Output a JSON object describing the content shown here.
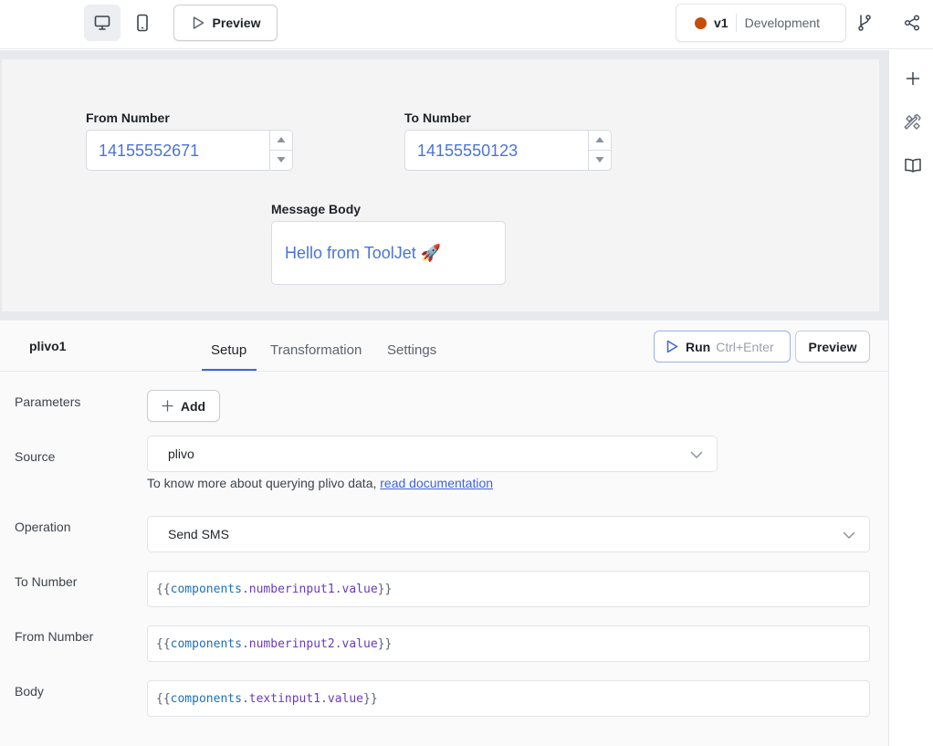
{
  "topbar": {
    "preview_label": "Preview",
    "version_label": "v1",
    "environment_label": "Development"
  },
  "canvas": {
    "from_number_label": "From Number",
    "from_number_value": "14155552671",
    "to_number_label": "To Number",
    "to_number_value": "14155550123",
    "message_body_label": "Message Body",
    "message_body_value": "Hello from ToolJet 🚀"
  },
  "query": {
    "name": "plivo1",
    "tabs": [
      {
        "label": "Setup",
        "active": true
      },
      {
        "label": "Transformation",
        "active": false
      },
      {
        "label": "Settings",
        "active": false
      }
    ],
    "run_label": "Run",
    "run_shortcut": "Ctrl+Enter",
    "preview_label": "Preview",
    "params": {
      "parameters_label": "Parameters",
      "add_label": "Add",
      "source_label": "Source",
      "source_value": "plivo",
      "help_prefix": "To know more about querying plivo data,",
      "help_link": "read documentation",
      "operation_label": "Operation",
      "operation_value": "Send SMS",
      "to_number_label": "To Number",
      "from_number_label": "From Number",
      "body_label": "Body"
    },
    "code": {
      "to_number": {
        "obj": "components",
        "comp": "numberinput1",
        "prop": "value"
      },
      "from_number": {
        "obj": "components",
        "comp": "numberinput2",
        "prop": "value"
      },
      "body": {
        "obj": "components",
        "comp": "textinput1",
        "prop": "value"
      }
    }
  },
  "colors": {
    "accent": "#3e63dd",
    "env_dot": "#c44d0a",
    "input_text": "#4a73d8"
  },
  "icons": {
    "desktop": "monitor-icon",
    "mobile": "mobile-icon",
    "play": "play-icon",
    "branch": "git-branch-icon",
    "share": "share-icon",
    "add": "plus-icon",
    "inspector": "tools-icon",
    "docs": "book-icon"
  }
}
